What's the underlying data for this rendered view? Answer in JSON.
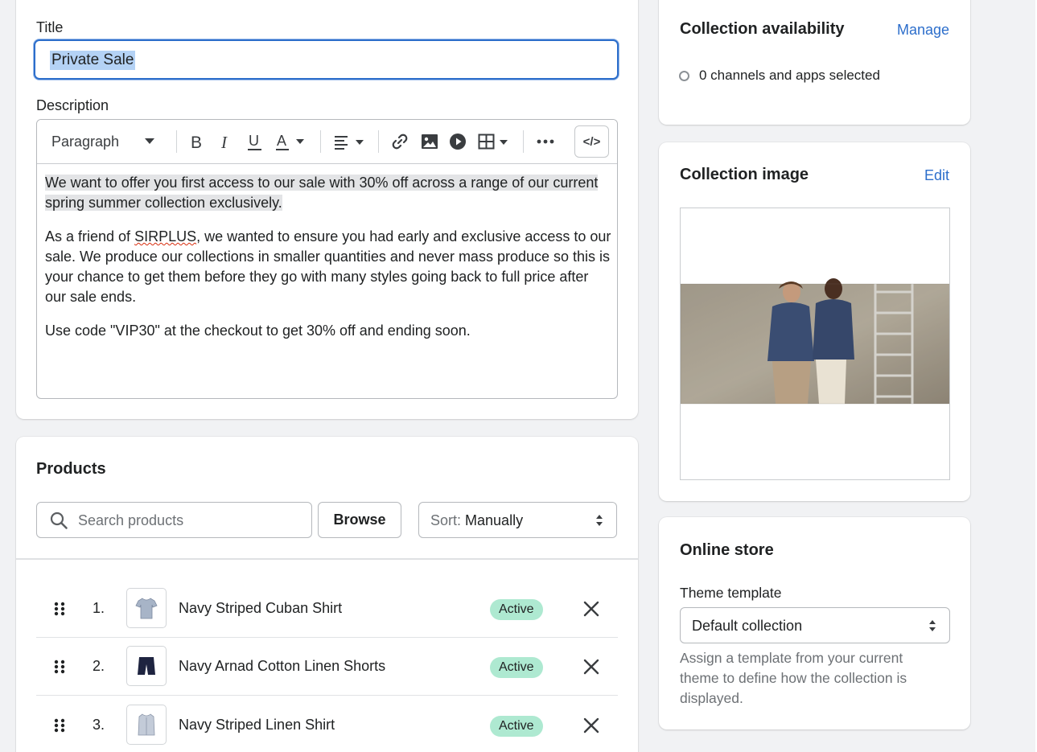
{
  "colors": {
    "accent": "#2c6ecb",
    "badge_active": "#aee9d1",
    "page_bg": "#f1f2f4"
  },
  "main": {
    "title_label": "Title",
    "title_value": "Private Sale",
    "description_label": "Description",
    "toolbar": {
      "paragraph_label": "Paragraph",
      "icons": [
        "bold-icon",
        "italic-icon",
        "underline-icon",
        "text-color-icon",
        "align-icon",
        "link-icon",
        "image-icon",
        "video-icon",
        "table-icon",
        "more-icon",
        "code-icon"
      ]
    },
    "body": {
      "p1": "We want to offer you first access to our sale with 30% off across a range of our current spring summer collection exclusively.",
      "p2_before": "As a friend of ",
      "p2_brand": "SIRPLUS",
      "p2_after": ", we wanted to ensure you had early and exclusive access to our sale. We produce our collections in smaller quantities and never mass produce so this is your chance to get them before they go with many styles going back to full price after our sale ends.",
      "p3": "Use code \"VIP30\" at the checkout to get 30% off and ending soon."
    }
  },
  "products": {
    "title": "Products",
    "search_placeholder": "Search products",
    "browse_label": "Browse",
    "sort_key": "Sort:",
    "sort_value": "Manually",
    "items": [
      {
        "index": "1.",
        "name": "Navy Striped Cuban Shirt",
        "status": "Active"
      },
      {
        "index": "2.",
        "name": "Navy Arnad Cotton Linen Shorts",
        "status": "Active"
      },
      {
        "index": "3.",
        "name": "Navy Striped Linen Shirt",
        "status": "Active"
      }
    ]
  },
  "availability": {
    "title": "Collection availability",
    "manage_label": "Manage",
    "status": "0 channels and apps selected"
  },
  "collection_image": {
    "title": "Collection image",
    "edit_label": "Edit"
  },
  "online_store": {
    "title": "Online store",
    "theme_label": "Theme template",
    "theme_value": "Default collection",
    "help_text": "Assign a template from your current theme to define how the collection is displayed."
  }
}
